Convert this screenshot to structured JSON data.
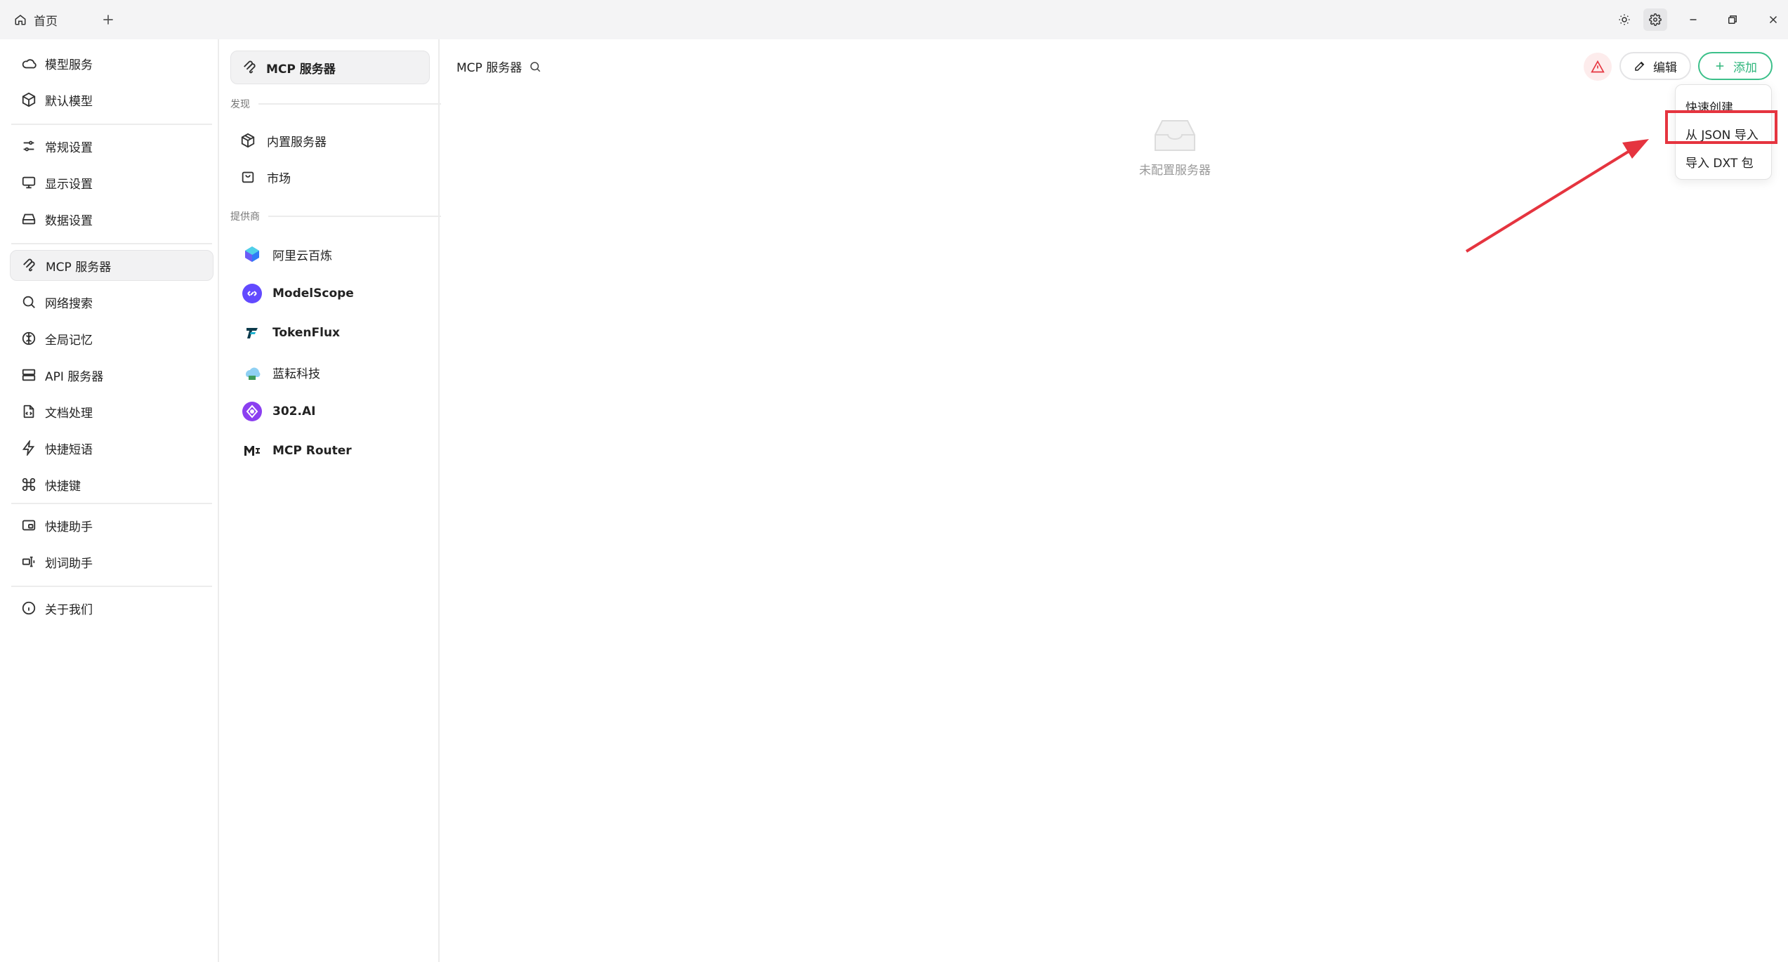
{
  "titlebar": {
    "tab_label": "首页"
  },
  "sidebar": {
    "items": [
      {
        "label": "模型服务",
        "icon": "cloud-icon"
      },
      {
        "label": "默认模型",
        "icon": "cube-icon"
      },
      {
        "label": "常规设置",
        "icon": "sliders-icon"
      },
      {
        "label": "显示设置",
        "icon": "monitor-icon"
      },
      {
        "label": "数据设置",
        "icon": "drive-icon"
      },
      {
        "label": "MCP 服务器",
        "icon": "mcp-icon"
      },
      {
        "label": "网络搜索",
        "icon": "search-icon"
      },
      {
        "label": "全局记忆",
        "icon": "brain-icon"
      },
      {
        "label": "API 服务器",
        "icon": "server-icon"
      },
      {
        "label": "文档处理",
        "icon": "file-code-icon"
      },
      {
        "label": "快捷短语",
        "icon": "zap-icon"
      },
      {
        "label": "快捷键",
        "icon": "command-icon"
      },
      {
        "label": "快捷助手",
        "icon": "window-icon"
      },
      {
        "label": "划词助手",
        "icon": "text-select-icon"
      },
      {
        "label": "关于我们",
        "icon": "info-icon"
      }
    ]
  },
  "midpanel": {
    "active_label": "MCP 服务器",
    "section_discover": "发现",
    "discover_items": [
      {
        "label": "内置服务器",
        "icon": "package-icon"
      },
      {
        "label": "市场",
        "icon": "shopping-bag-icon"
      }
    ],
    "section_providers": "提供商",
    "providers": [
      {
        "label": "阿里云百炼",
        "icon": "bailian-logo-icon"
      },
      {
        "label": "ModelScope",
        "icon": "modelscope-logo-icon"
      },
      {
        "label": "TokenFlux",
        "icon": "tokenflux-logo-icon"
      },
      {
        "label": "蓝耘科技",
        "icon": "lanyun-logo-icon"
      },
      {
        "label": "302.AI",
        "icon": "302ai-logo-icon"
      },
      {
        "label": "MCP Router",
        "icon": "mcp-router-logo-icon"
      }
    ]
  },
  "main": {
    "title": "MCP 服务器",
    "edit_label": "编辑",
    "add_label": "添加",
    "empty_text": "未配置服务器",
    "dropdown": [
      "快速创建",
      "从 JSON 导入",
      "导入 DXT 包"
    ]
  },
  "colors": {
    "accent_green": "#2fb57c",
    "highlight_red": "#e5343f",
    "warning_red": "#e5343f"
  }
}
